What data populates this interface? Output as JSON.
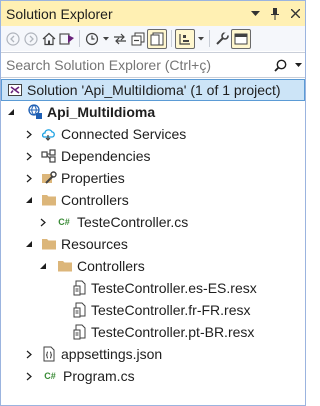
{
  "window": {
    "title": "Solution Explorer"
  },
  "search": {
    "placeholder": "Search Solution Explorer (Ctrl+ç)"
  },
  "tree": {
    "solution": "Solution 'Api_MultiIdioma' (1 of 1 project)",
    "project": "Api_MultiIdioma",
    "connected_services": "Connected Services",
    "dependencies": "Dependencies",
    "properties": "Properties",
    "controllers": "Controllers",
    "teste_controller": "TesteController.cs",
    "resources": "Resources",
    "resources_controllers": "Controllers",
    "resx_es": "TesteController.es-ES.resx",
    "resx_fr": "TesteController.fr-FR.resx",
    "resx_pt": "TesteController.pt-BR.resx",
    "appsettings": "appsettings.json",
    "program": "Program.cs",
    "cs_badge": "C#"
  },
  "colors": {
    "titlebar": "#fff0b3",
    "selection": "#cce4f7",
    "folder": "#dcb67a",
    "csharp": "#388a34",
    "project_icon": "#1e5fb4"
  }
}
